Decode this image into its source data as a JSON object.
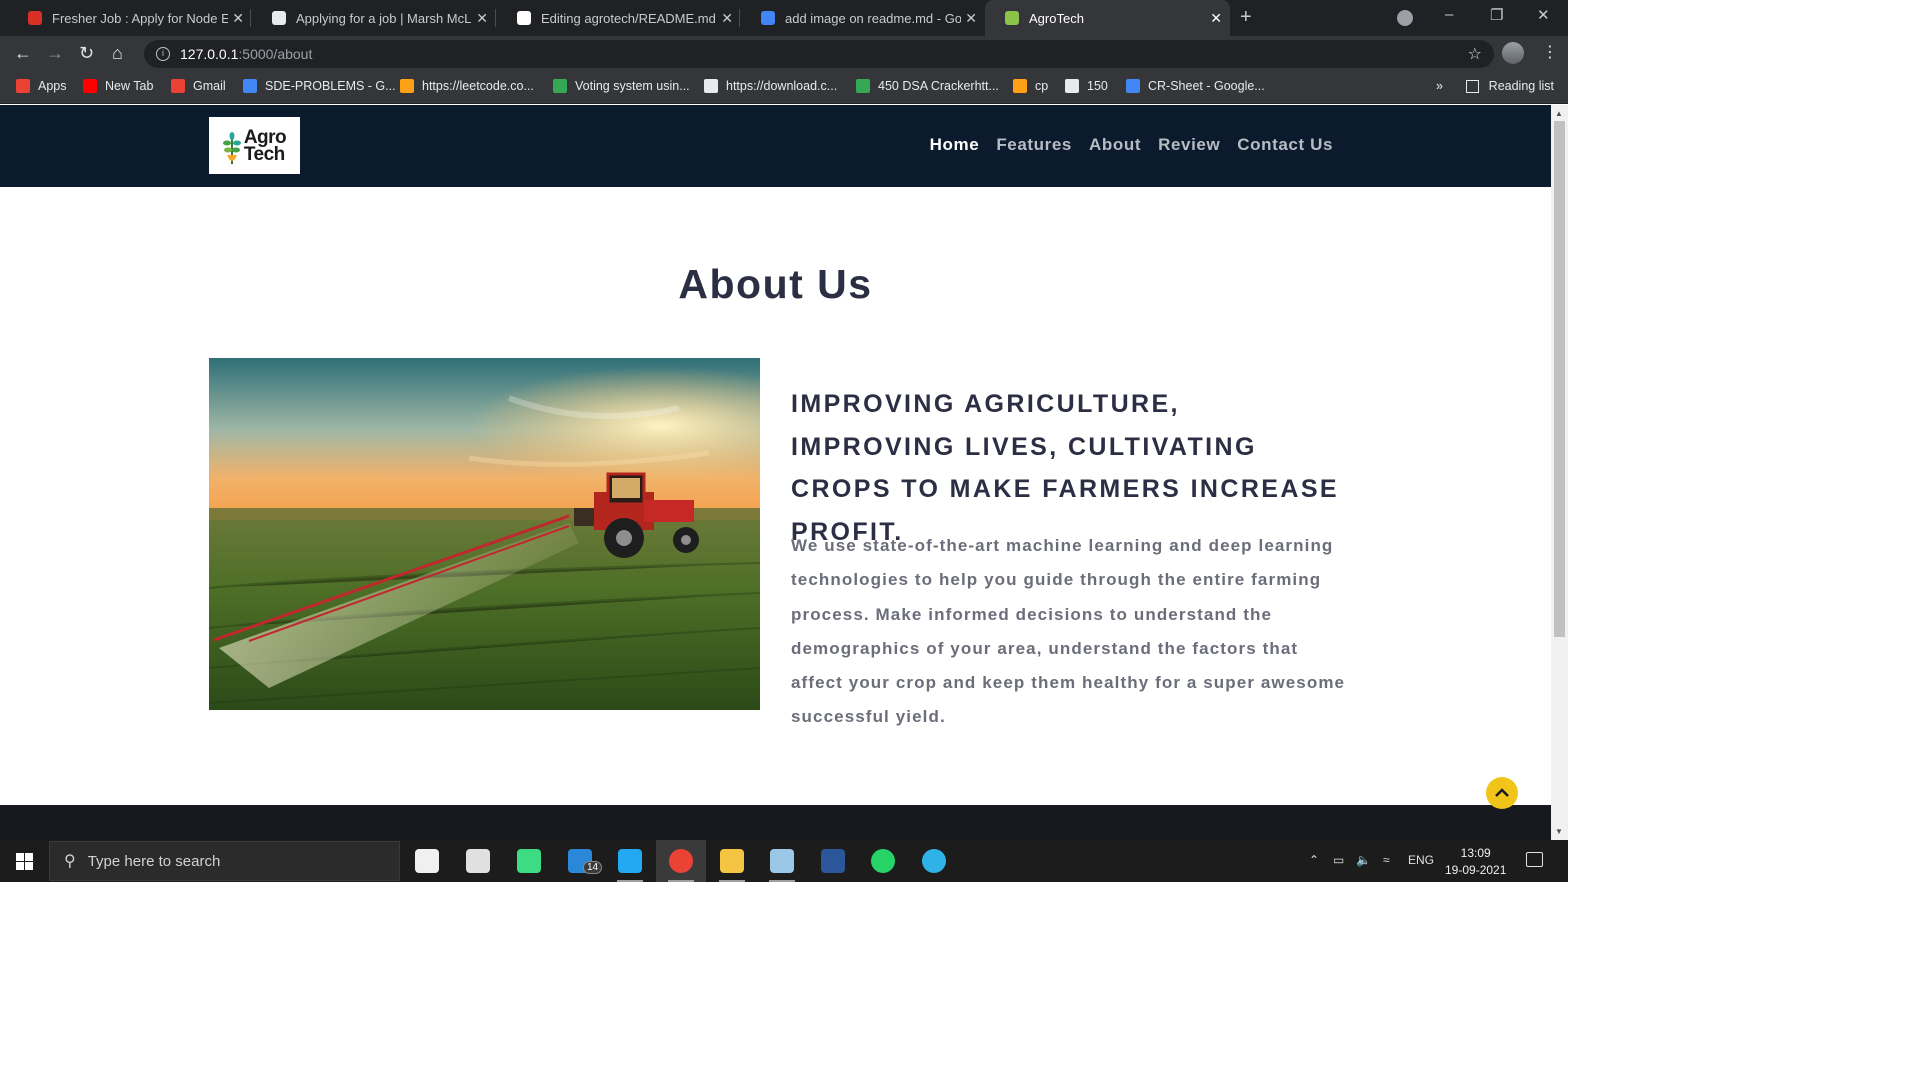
{
  "browser": {
    "tabs": [
      {
        "title": "Fresher Job : Apply for Node Eng",
        "active": false,
        "favicon_color": "#d93025"
      },
      {
        "title": "Applying for a job | Marsh McLen",
        "active": false,
        "favicon_color": "#e8eaed"
      },
      {
        "title": "Editing agrotech/README.md at",
        "active": false,
        "favicon_color": "#ffffff"
      },
      {
        "title": "add image on readme.md - Goog",
        "active": false,
        "favicon_color": "#4285f4"
      },
      {
        "title": "AgroTech",
        "active": true,
        "favicon_color": "#8bc34a"
      }
    ],
    "new_tab_label": "+",
    "address": {
      "host": "127.0.0.1",
      "path": ":5000/about"
    },
    "bookmarks": [
      {
        "label": "Apps",
        "icon_color": "#ea4335"
      },
      {
        "label": "New Tab",
        "icon_color": "#ff0000"
      },
      {
        "label": "Gmail",
        "icon_color": "#ea4335"
      },
      {
        "label": "SDE-PROBLEMS - G...",
        "icon_color": "#4285f4"
      },
      {
        "label": "https://leetcode.co...",
        "icon_color": "#ffa116"
      },
      {
        "label": "Voting system usin...",
        "icon_color": "#34a853"
      },
      {
        "label": "https://download.c...",
        "icon_color": "#e8eaed"
      },
      {
        "label": "450 DSA Crackerhtt...",
        "icon_color": "#34a853"
      },
      {
        "label": "cp",
        "icon_color": "#ffa116"
      },
      {
        "label": "150",
        "icon_color": "#e8eaed"
      },
      {
        "label": "CR-Sheet - Google...",
        "icon_color": "#4285f4"
      }
    ],
    "bookmarks_overflow": "»",
    "reading_list": "Reading list"
  },
  "site": {
    "logo": {
      "line1": "Agro",
      "line2": "Tech"
    },
    "nav": [
      {
        "label": "Home",
        "active": true
      },
      {
        "label": "Features",
        "active": false
      },
      {
        "label": "About",
        "active": false
      },
      {
        "label": "Review",
        "active": false
      },
      {
        "label": "Contact Us",
        "active": false
      }
    ],
    "about": {
      "title": "About Us",
      "headline": "IMPROVING AGRICULTURE, IMPROVING LIVES, CULTIVATING CROPS TO MAKE FARMERS INCREASE PROFIT.",
      "description": "We use state-of-the-art machine learning and deep learning technologies to help you guide through the entire farming process. Make informed decisions to understand the demographics of your area, understand the factors that affect your crop and keep them healthy for a super awesome successful yield.",
      "image": "tractor spraying crop field at sunset"
    },
    "colors": {
      "nav_bg": "#0b1a2c",
      "title": "#2c2f44",
      "body_text": "#6b6e7a",
      "scroll_top_btn": "#f0c419"
    }
  },
  "taskbar": {
    "search_placeholder": "Type here to search",
    "apps": [
      {
        "name": "store-icon",
        "color": "#f0f0f0"
      },
      {
        "name": "settings-icon",
        "color": "#e0e0e0"
      },
      {
        "name": "pen-icon",
        "color": "#3ddc84"
      },
      {
        "name": "mail-icon",
        "color": "#2b88d8",
        "badge": "14"
      },
      {
        "name": "vscode-icon",
        "color": "#23a9f2"
      },
      {
        "name": "chrome-icon",
        "color": "#ea4335"
      },
      {
        "name": "file-explorer-icon",
        "color": "#f4c542"
      },
      {
        "name": "notepad-icon",
        "color": "#9cc8e8"
      },
      {
        "name": "word-icon",
        "color": "#2b579a"
      },
      {
        "name": "whatsapp-icon",
        "color": "#25d366"
      },
      {
        "name": "edge-icon",
        "color": "#2fb3e6"
      }
    ],
    "language": "ENG",
    "time": "13:09",
    "date": "19-09-2021"
  }
}
